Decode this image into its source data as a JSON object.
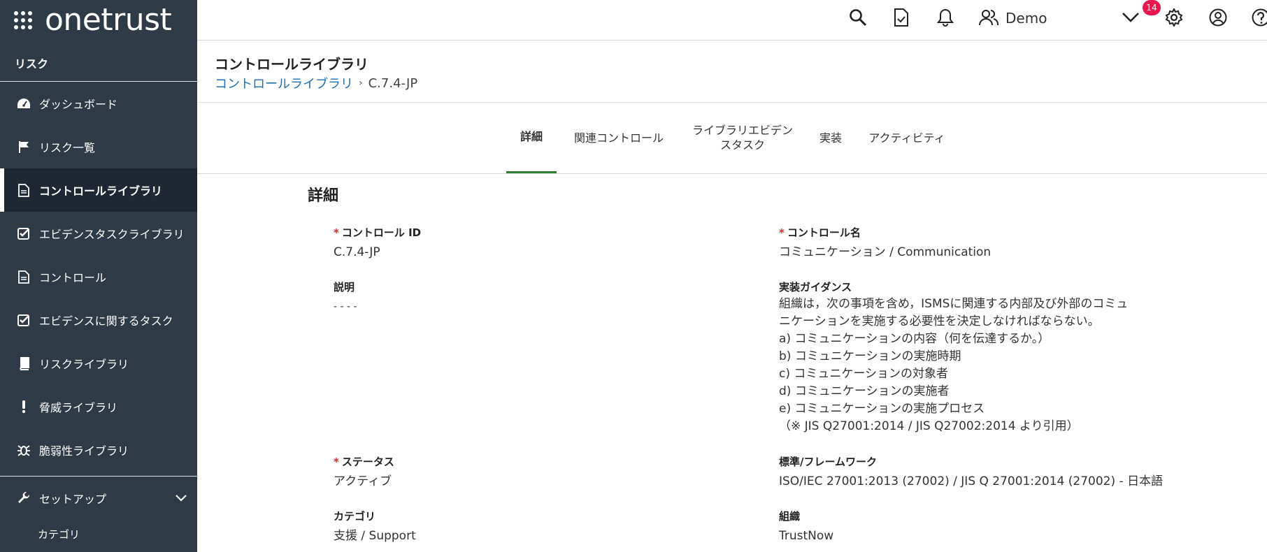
{
  "brand": {
    "logo_text": "onetrust"
  },
  "sidebar": {
    "section": "リスク",
    "items": [
      {
        "label": "ダッシュボード",
        "icon": "dashboard-icon"
      },
      {
        "label": "リスク一覧",
        "icon": "flag-icon"
      },
      {
        "label": "コントロールライブラリ",
        "icon": "document-icon",
        "active": true
      },
      {
        "label": "エビデンスタスクライブラリ",
        "icon": "checkbox-icon"
      },
      {
        "label": "コントロール",
        "icon": "document-icon"
      },
      {
        "label": "エビデンスに関するタスク",
        "icon": "checkbox-icon"
      },
      {
        "label": "リスクライブラリ",
        "icon": "book-icon"
      },
      {
        "label": "脅威ライブラリ",
        "icon": "exclamation-icon"
      },
      {
        "label": "脆弱性ライブラリ",
        "icon": "bug-icon"
      }
    ],
    "setup": {
      "label": "セットアップ",
      "icon": "wrench-icon"
    },
    "setup_sub": [
      "カテゴリ"
    ]
  },
  "topbar": {
    "notification_count": "14",
    "user_name": "Demo"
  },
  "header": {
    "title": "コントロールライブラリ",
    "breadcrumb_link": "コントロールライブラリ",
    "breadcrumb_sep": "›",
    "breadcrumb_current": "C.7.4-JP"
  },
  "tabs": [
    {
      "label": "詳細",
      "active": true
    },
    {
      "label": "関連コントロール"
    },
    {
      "label": "ライブラリエビデン\nスタスク"
    },
    {
      "label": "実装"
    },
    {
      "label": "アクティビティ"
    }
  ],
  "details": {
    "section_title": "詳細",
    "required_mark": "*",
    "control_id_label": "コントロール ID",
    "control_id": "C.7.4-JP",
    "control_name_label": "コントロール名",
    "control_name": "コミュニケーション / Communication",
    "description_label": "説明",
    "description": "- - - -",
    "guidance_label": "実装ガイダンス",
    "guidance": "組織は，次の事項を含め，ISMSに関連する内部及び外部のコミュ\nニケーションを実施する必要性を決定しなければならない。\na) コミュニケーションの内容（何を伝達するか。）\nb) コミュニケーションの実施時期\nc) コミュニケーションの対象者\nd) コミュニケーションの実施者\ne) コミュニケーションの実施プロセス\n（※ JIS Q27001:2014 / JIS Q27002:2014 より引用）",
    "status_label": "ステータス",
    "status": "アクティブ",
    "framework_label": "標準/フレームワーク",
    "framework": "ISO/IEC 27001:2013 (27002) / JIS Q 27001:2014 (27002) - 日本語",
    "category_label": "カテゴリ",
    "category": "支援 / Support",
    "org_label": "組織",
    "org": "TrustNow"
  }
}
